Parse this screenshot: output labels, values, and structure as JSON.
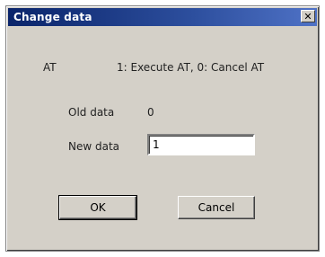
{
  "window": {
    "title": "Change data",
    "close_glyph": "✕"
  },
  "at": {
    "label": "AT",
    "description": "1: Execute AT, 0: Cancel AT"
  },
  "old_data": {
    "label": "Old data",
    "value": "0"
  },
  "new_data": {
    "label": "New data",
    "value": "1"
  },
  "buttons": {
    "ok": "OK",
    "cancel": "Cancel"
  }
}
